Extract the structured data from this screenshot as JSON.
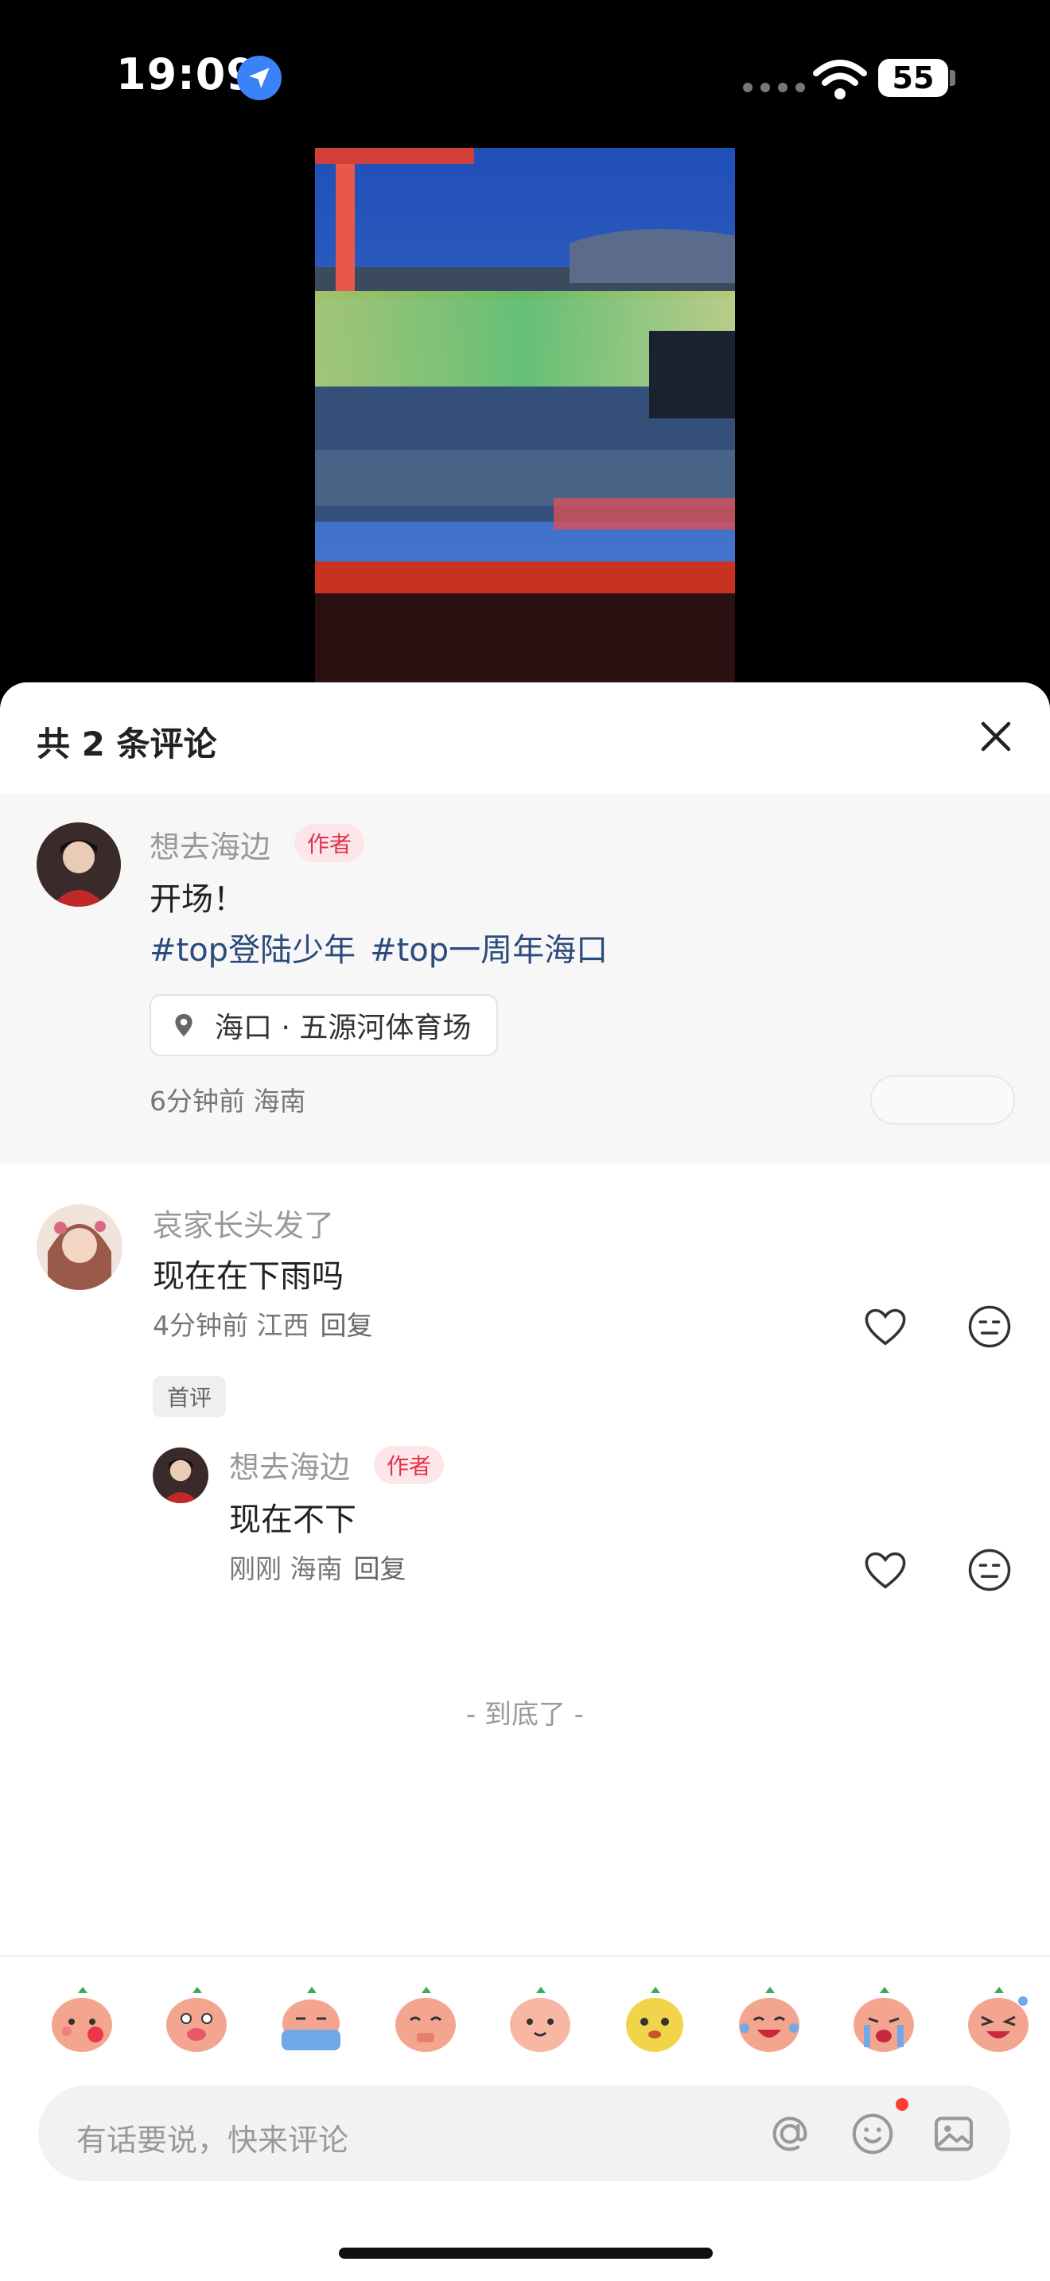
{
  "status_bar": {
    "time": "19:09",
    "battery": "55"
  },
  "sheet": {
    "title": "共 2 条评论"
  },
  "post": {
    "author_name": "想去海边",
    "author_tag": "作者",
    "text": "开场！",
    "hashtags": [
      "#top登陆少年",
      "#top一周年海口"
    ],
    "location": "海口 · 五源河体育场",
    "meta": "6分钟前 海南"
  },
  "comments": [
    {
      "name": "哀家长头发了",
      "text": "现在在下雨吗",
      "meta": "4分钟前 江西",
      "reply_label": "回复",
      "badge": "首评"
    }
  ],
  "reply": {
    "name": "想去海边",
    "tag": "作者",
    "text": "现在不下",
    "meta": "刚刚 海南",
    "reply_label": "回复"
  },
  "end_text": "- 到底了 -",
  "input": {
    "placeholder": "有话要说，快来评论"
  },
  "colors": {
    "author_tag_bg": "#fde6ea",
    "author_tag_text": "#e0344b",
    "hashtag": "#2a4b7c",
    "notification_dot": "#ff3b30"
  }
}
